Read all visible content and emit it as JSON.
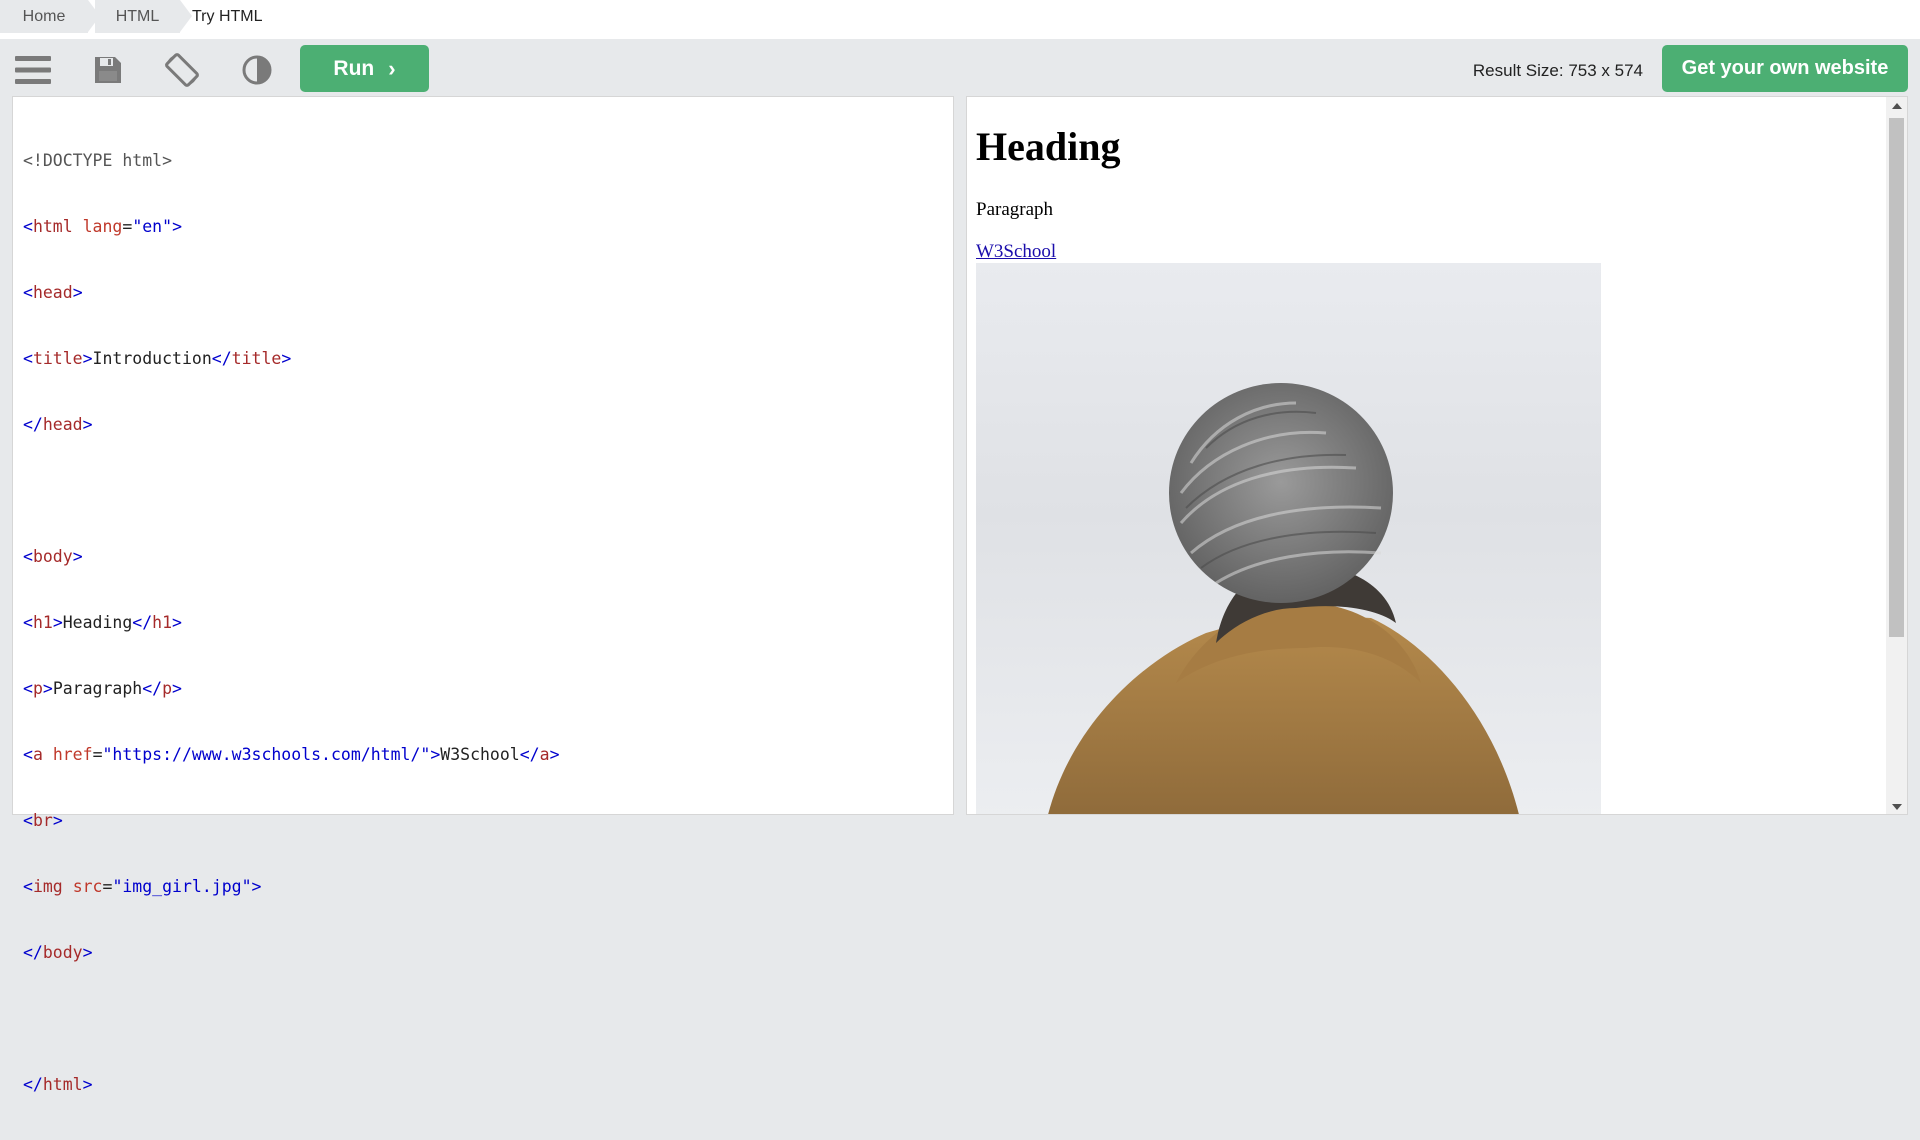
{
  "breadcrumb": {
    "items": [
      "Home",
      "HTML"
    ],
    "current": "Try HTML"
  },
  "toolbar": {
    "icons": [
      "menu-icon",
      "save-icon",
      "rotate-icon",
      "contrast-icon"
    ],
    "run_label": "Run",
    "result_size": "Result Size: 753 x 574",
    "own_website_label": "Get your own website"
  },
  "editor": {
    "lines": [
      "<!DOCTYPE html>",
      "<html lang=\"en\">",
      "<head>",
      "<title>Introduction</title>",
      "</head>",
      "",
      "<body>",
      "<h1>Heading</h1>",
      "<p>Paragraph</p>",
      "<a href=\"https://www.w3schools.com/html/\">W3School</a>",
      "<br>",
      "<img src=\"img_girl.jpg\">",
      "</body>",
      "",
      "</html>"
    ]
  },
  "result": {
    "heading": "Heading",
    "paragraph": "Paragraph",
    "link_text": "W3School",
    "image_description": "girl-in-knit-hat-photo"
  },
  "colors": {
    "accent_green": "#4caf73",
    "toolbar_bg": "#e7e9eb",
    "code_tag": "#a52a2a",
    "code_bracket": "#0000cd",
    "code_value": "#0000cd"
  }
}
